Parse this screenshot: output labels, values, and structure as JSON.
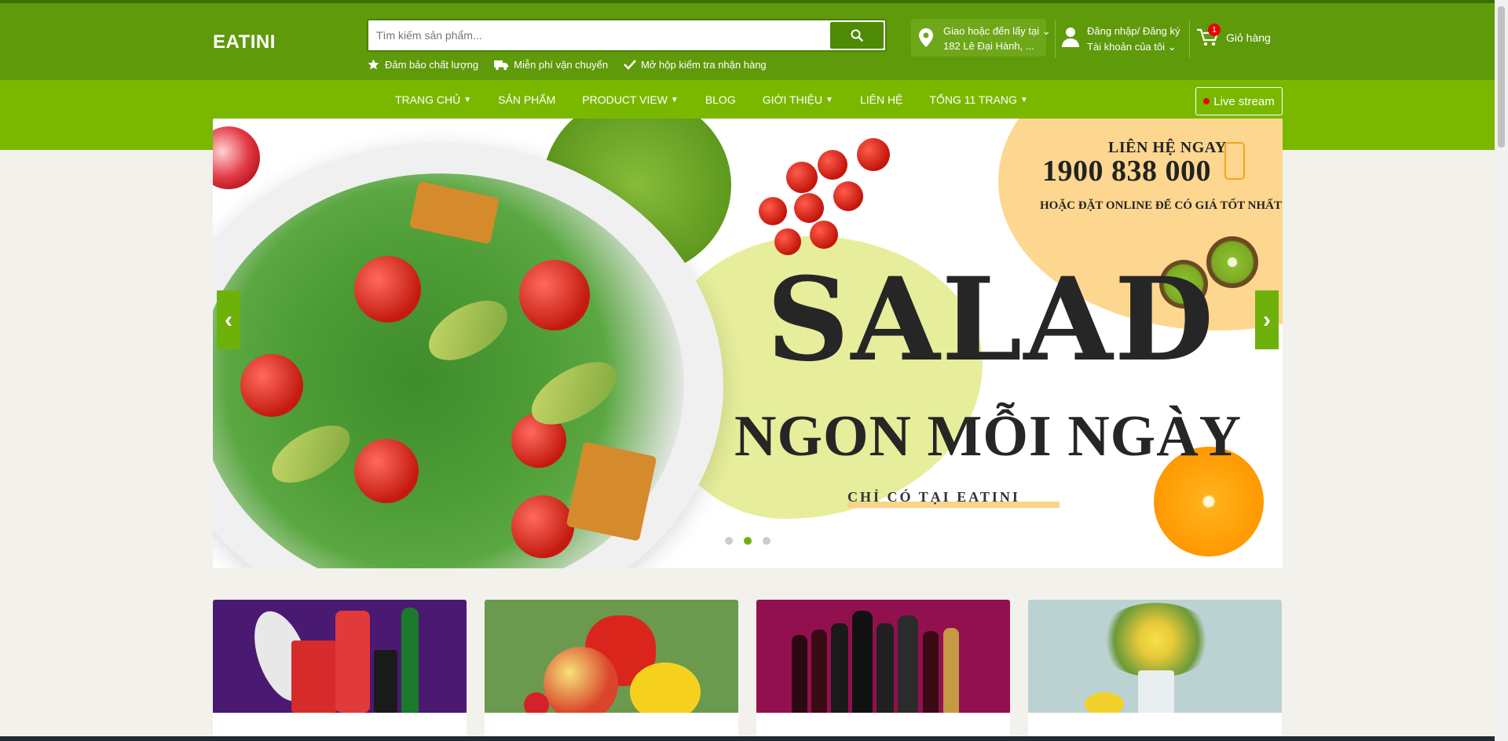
{
  "header": {
    "logo": "EATINI",
    "search": {
      "placeholder": "Tìm kiếm sản phẩm..."
    },
    "perks": [
      {
        "icon": "star-icon",
        "label": "Đảm bảo chất lượng"
      },
      {
        "icon": "truck-icon",
        "label": "Miễn phí vận chuyển"
      },
      {
        "icon": "check-icon",
        "label": "Mở hộp kiểm tra nhận hàng"
      }
    ],
    "location": {
      "line1": "Giao hoặc đến lấy tại",
      "line2": "182 Lê Đại Hành, ..."
    },
    "account": {
      "line1": "Đăng nhập/ Đăng ký",
      "line2": "Tài khoản của tôi"
    },
    "cart": {
      "label": "Giỏ hàng",
      "count": "1"
    }
  },
  "nav": {
    "items": [
      {
        "label": "TRANG CHỦ",
        "dropdown": true
      },
      {
        "label": "SẢN PHẨM",
        "dropdown": false
      },
      {
        "label": "PRODUCT VIEW",
        "dropdown": true
      },
      {
        "label": "BLOG",
        "dropdown": false
      },
      {
        "label": "GIỚI THIỆU",
        "dropdown": true
      },
      {
        "label": "LIÊN HỆ",
        "dropdown": false
      },
      {
        "label": "TỔNG 11 TRANG",
        "dropdown": true
      }
    ],
    "live": "Live stream"
  },
  "banner": {
    "contact": "LIÊN HỆ NGAY",
    "phone": "1900 838 000",
    "order": "HOẶC ĐẶT ONLINE ĐỂ CÓ GIÁ TỐT NHẤT",
    "headline": "SALAD",
    "subheadline": "NGON MỖI NGÀY",
    "tagline": "CHỈ CÓ TẠI EATINI",
    "slide_count": 3,
    "active_slide": 2
  },
  "colors": {
    "header_bg": "#5f9a0b",
    "nav_bg": "#7ab800",
    "accent": "#6fb10b",
    "page_bg": "#f3f1ec",
    "banner_yellow": "#fdd78f"
  },
  "categories": [
    {
      "name": "snacks-drinks",
      "bg": "#4a1a73"
    },
    {
      "name": "fruits-vegetables",
      "bg": "#6b9a4e"
    },
    {
      "name": "wine",
      "bg": "#93104f"
    },
    {
      "name": "flowers",
      "bg": "#bcd2d2"
    }
  ]
}
